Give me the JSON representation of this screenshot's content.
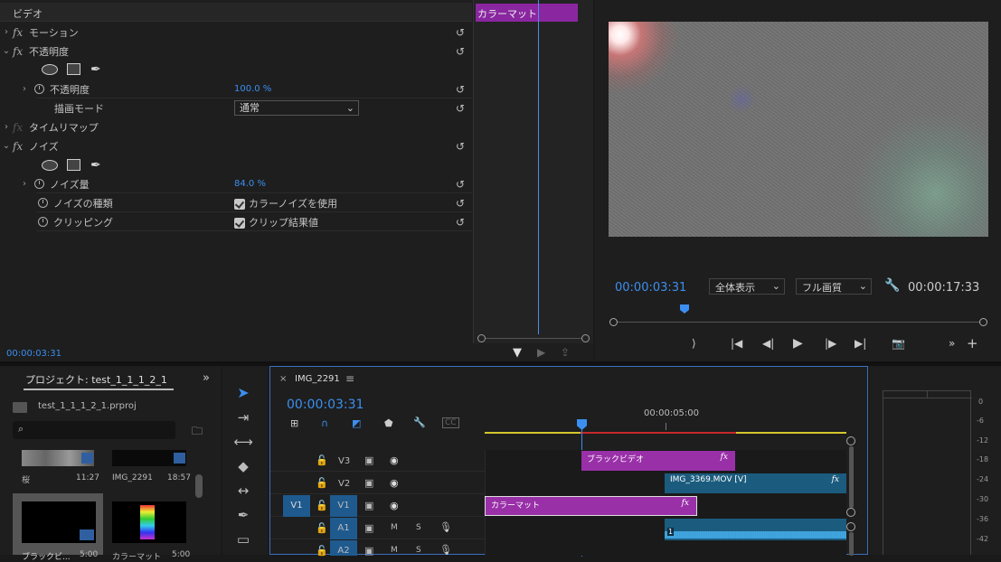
{
  "effect_controls": {
    "section": "ビデオ",
    "motion": "モーション",
    "opacity": "不透明度",
    "opacity_param": "不透明度",
    "opacity_value": "100.0 %",
    "blend_mode": "描画モード",
    "blend_value": "通常",
    "time_remap": "タイムリマップ",
    "noise": "ノイズ",
    "noise_amount": "ノイズ量",
    "noise_amount_value": "84.0 %",
    "noise_type": "ノイズの種類",
    "noise_type_value": "カラーノイズを使用",
    "clipping": "クリッピング",
    "clipping_value": "クリップ結果値",
    "timecode": "00:00:03:31",
    "clip_name": "カラーマット"
  },
  "program": {
    "timecode": "00:00:03:31",
    "zoom": "全体表示",
    "quality": "フル画質",
    "duration": "00:00:17:33"
  },
  "project": {
    "tab": "プロジェクト: test_1_1_1_2_1",
    "file": "test_1_1_1_2_1.prproj",
    "items": [
      {
        "name": "桜",
        "duration": "11:27"
      },
      {
        "name": "IMG_2291",
        "duration": "18:57"
      },
      {
        "name": "ブラックビ...",
        "duration": "5:00"
      },
      {
        "name": "カラーマット",
        "duration": "5:00"
      }
    ]
  },
  "timeline": {
    "tab": "IMG_2291",
    "timecode": "00:00:03:31",
    "ruler_label": "00:00:05:00",
    "tracks": [
      {
        "name": "V3"
      },
      {
        "name": "V2"
      },
      {
        "name": "V1",
        "source": "V1"
      },
      {
        "name": "A1"
      },
      {
        "name": "A2"
      }
    ],
    "clips": {
      "black_video": "ブラックビデオ",
      "img_clip": "IMG_3369.MOV [V]",
      "color_matte": "カラーマット",
      "audio_num": "1"
    },
    "btn_m": "M",
    "btn_s": "S"
  },
  "meter": {
    "labels": [
      "0",
      "-6",
      "-12",
      "-18",
      "-24",
      "-30",
      "-36",
      "-42"
    ]
  }
}
